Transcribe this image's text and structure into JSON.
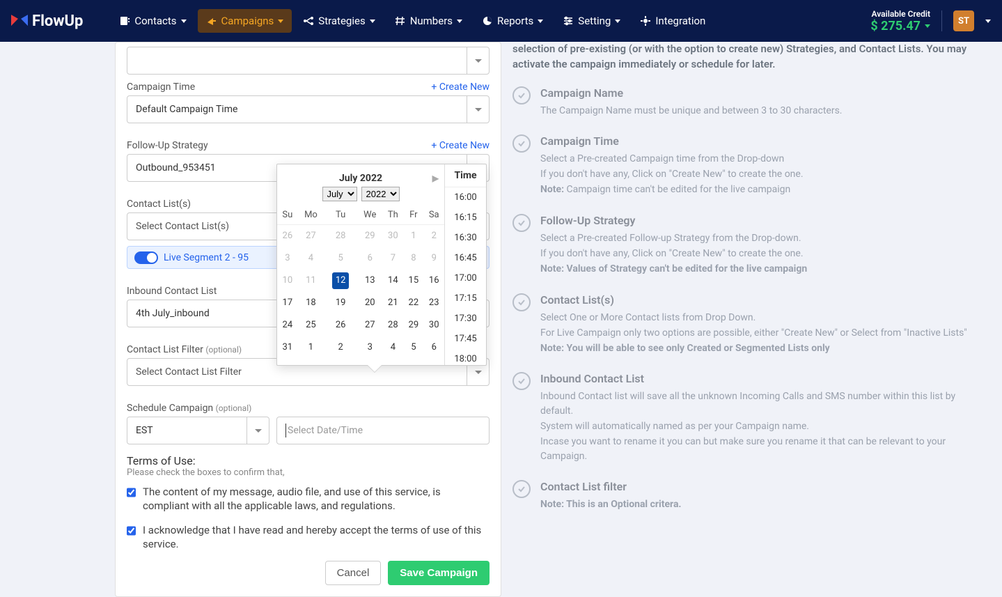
{
  "brand": "FlowUp",
  "nav": [
    {
      "label": "Contacts",
      "icon": "contacts-icon"
    },
    {
      "label": "Campaigns",
      "icon": "campaigns-icon",
      "active": true
    },
    {
      "label": "Strategies",
      "icon": "strategies-icon"
    },
    {
      "label": "Numbers",
      "icon": "numbers-icon"
    },
    {
      "label": "Reports",
      "icon": "reports-icon"
    },
    {
      "label": "Setting",
      "icon": "setting-icon"
    },
    {
      "label": "Integration",
      "icon": "integration-icon",
      "no_caret": true
    }
  ],
  "credit": {
    "label": "Available Credit",
    "value": "$ 275.47"
  },
  "user_initials": "ST",
  "form": {
    "campaign_time_label": "Campaign Time",
    "create_new": "+ Create New",
    "campaign_time_value": "Default Campaign Time",
    "strategy_label": "Follow-Up Strategy",
    "strategy_value": "Outbound_953451",
    "contact_list_label": "Contact List(s)",
    "contact_list_placeholder": "Select Contact List(s)",
    "segment_chip": "Live Segment 2 - 95",
    "inbound_label": "Inbound Contact List",
    "inbound_value": "4th July_inbound",
    "filter_label": "Contact List Filter",
    "filter_placeholder": "Select Contact List Filter",
    "optional": "(optional)",
    "schedule_label": "Schedule Campaign",
    "tz_value": "EST",
    "date_placeholder": "Select Date/Time",
    "terms_head": "Terms of Use:",
    "terms_sub": "Please check the boxes to confirm that,",
    "term1": "The content of my message, audio file, and use of this service, is compliant with all the applicable laws, and regulations.",
    "term2": "I acknowledge that I have read and hereby accept the terms of use of this service.",
    "cancel": "Cancel",
    "save": "Save Campaign"
  },
  "calendar": {
    "title": "July 2022",
    "month": "July",
    "year": "2022",
    "dow": [
      "Su",
      "Mo",
      "Tu",
      "We",
      "Th",
      "Fr",
      "Sa"
    ],
    "weeks": [
      [
        {
          "d": "26",
          "dim": true
        },
        {
          "d": "27",
          "dim": true
        },
        {
          "d": "28",
          "dim": true
        },
        {
          "d": "29",
          "dim": true
        },
        {
          "d": "30",
          "dim": true
        },
        {
          "d": "1",
          "dim": true
        },
        {
          "d": "2",
          "dim": true
        }
      ],
      [
        {
          "d": "3",
          "dim": true
        },
        {
          "d": "4",
          "dim": true
        },
        {
          "d": "5",
          "dim": true
        },
        {
          "d": "6",
          "dim": true
        },
        {
          "d": "7",
          "dim": true
        },
        {
          "d": "8",
          "dim": true
        },
        {
          "d": "9",
          "dim": true
        }
      ],
      [
        {
          "d": "10",
          "dim": true
        },
        {
          "d": "11",
          "dim": true
        },
        {
          "d": "12",
          "sel": true
        },
        {
          "d": "13"
        },
        {
          "d": "14"
        },
        {
          "d": "15"
        },
        {
          "d": "16"
        }
      ],
      [
        {
          "d": "17"
        },
        {
          "d": "18"
        },
        {
          "d": "19"
        },
        {
          "d": "20"
        },
        {
          "d": "21"
        },
        {
          "d": "22"
        },
        {
          "d": "23"
        }
      ],
      [
        {
          "d": "24"
        },
        {
          "d": "25"
        },
        {
          "d": "26"
        },
        {
          "d": "27"
        },
        {
          "d": "28"
        },
        {
          "d": "29"
        },
        {
          "d": "30"
        }
      ],
      [
        {
          "d": "31"
        },
        {
          "d": "1"
        },
        {
          "d": "2"
        },
        {
          "d": "3"
        },
        {
          "d": "4"
        },
        {
          "d": "5"
        },
        {
          "d": "6"
        }
      ]
    ],
    "time_head": "Time",
    "times": [
      "16:00",
      "16:15",
      "16:30",
      "16:45",
      "17:00",
      "17:15",
      "17:30",
      "17:45",
      "18:00"
    ]
  },
  "help": {
    "intro": "selection of pre-existing (or with the option to create new) Strategies, and Contact Lists. You may activate the campaign immediately or schedule for later.",
    "items": [
      {
        "title": "Campaign Name",
        "body": [
          "The Campaign Name must be unique and between 3 to 30 characters."
        ]
      },
      {
        "title": "Campaign Time",
        "body": [
          "Select a Pre-created Campaign time from the Drop-down",
          "If you don't have any, Click on \"Create New\" to create the one.",
          "<b>Note:</b> Campaign time can't be edited for the live campaign"
        ]
      },
      {
        "title": "Follow-Up Strategy",
        "body": [
          "Select a Pre-created Follow-up Strategy from the Drop-down.",
          "If you don't have any, Click on \"Create New\" to create the one.",
          "<b>Note: Values of Strategy can't be edited for the live campaign</b>"
        ]
      },
      {
        "title": "Contact List(s)",
        "body": [
          "Select One or More Contact lists from Drop Down.",
          "For Live Campaign only two options are possible, either \"Create New\" or Select from \"Inactive Lists\"",
          "<b>Note: You will be able to see only Created or Segmented Lists only</b>"
        ]
      },
      {
        "title": "Inbound Contact List",
        "body": [
          "Inbound Contact list will save all the unknown Incoming Calls and SMS number within this list by default.",
          "System will automatically named as per your Campaign name.",
          "Incase you want to rename it you can but make sure you rename it that can be relevant to your Campaign."
        ]
      },
      {
        "title": "Contact List filter",
        "body": [
          "<b>Note: This is an Optional critera.</b>"
        ]
      }
    ]
  }
}
